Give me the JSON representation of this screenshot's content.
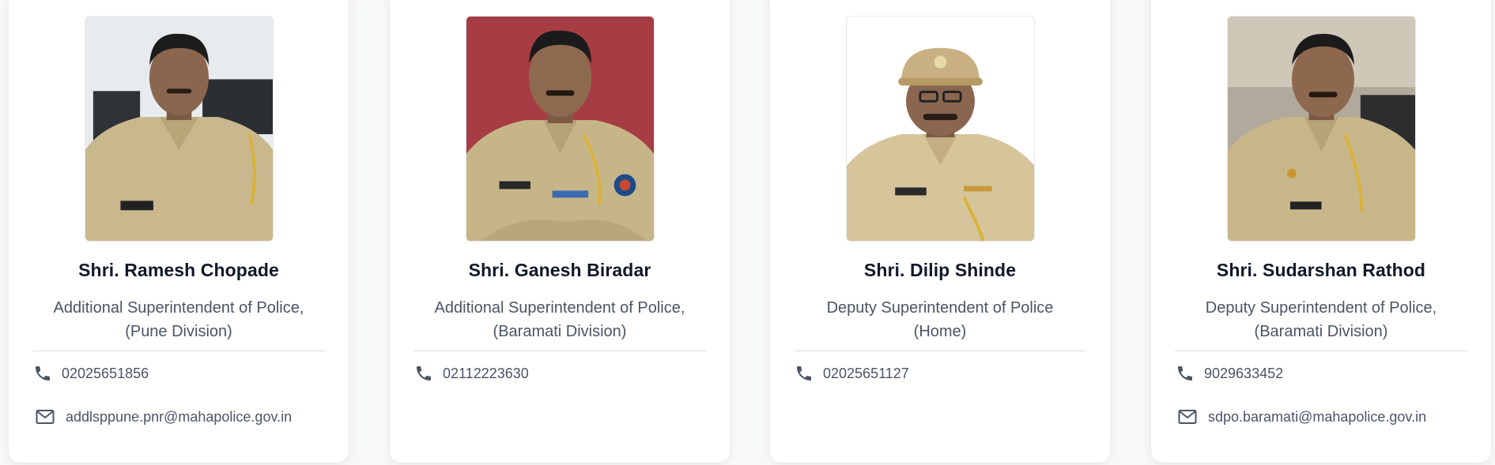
{
  "officers": [
    {
      "name": "Shri. Ramesh Chopade",
      "designation_line1": "Additional Superintendent of Police,",
      "designation_line2": "(Pune Division)",
      "phone": "02025651856",
      "email": "addlsppune.pnr@mahapolice.gov.in",
      "photo_alt": "officer-photo"
    },
    {
      "name": "Shri. Ganesh Biradar",
      "designation_line1": "Additional Superintendent of Police,",
      "designation_line2": "(Baramati Division)",
      "phone": "02112223630",
      "email": "",
      "photo_alt": "officer-photo"
    },
    {
      "name": "Shri. Dilip Shinde",
      "designation_line1": "Deputy Superintendent of Police",
      "designation_line2": "(Home)",
      "phone": "02025651127",
      "email": "",
      "photo_alt": "officer-photo"
    },
    {
      "name": "Shri. Sudarshan Rathod",
      "designation_line1": "Deputy Superintendent of Police,",
      "designation_line2": "(Baramati Division)",
      "phone": "9029633452",
      "email": "sdpo.baramati@mahapolice.gov.in",
      "photo_alt": "officer-photo"
    }
  ],
  "icons": {
    "phone": "phone-icon",
    "email": "mail-icon"
  },
  "colors": {
    "name_text": "#111827",
    "body_text": "#4b5563",
    "icon": "#4b5563",
    "uniform": "#c9b88d",
    "photo_bg_1": "#e9ecee",
    "photo_bg_2": "#b4464c",
    "photo_bg_3": "#ffffff",
    "photo_bg_4": "#b0a99c"
  }
}
